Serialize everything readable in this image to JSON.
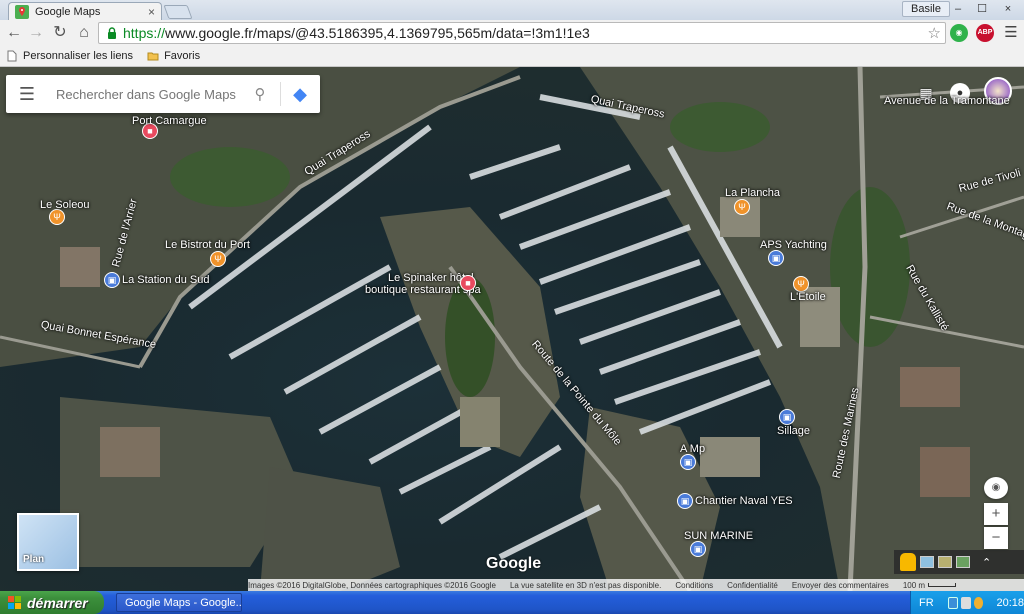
{
  "browser": {
    "tab_title": "Google Maps",
    "tab_close": "×",
    "user_name": "Basile",
    "win_minimize": "–",
    "win_maximize": "☐",
    "win_close": "×",
    "url_scheme": "https://",
    "url_rest": "www.google.fr/maps/@43.5186395,4.1369795,565m/data=!3m1!1e3",
    "ext_abp": "ABP",
    "bookmarks": [
      {
        "label": "Personnaliser les liens",
        "icon": "page-icon"
      },
      {
        "label": "Favoris",
        "icon": "folder-icon"
      }
    ]
  },
  "map": {
    "search_placeholder": "Rechercher dans Google Maps",
    "plan_label": "Plan",
    "logo": "Google",
    "labels": [
      {
        "text": "Port Camargue",
        "name": "label-port-camargue"
      },
      {
        "text": "Le Soleou",
        "name": "label-le-soleou"
      },
      {
        "text": "Le Bistrot du Port",
        "name": "label-le-bistrot-du-port"
      },
      {
        "text": "La Station du Sud",
        "name": "label-la-station-du-sud"
      },
      {
        "text": "Le Spinaker hôtel",
        "name": "label-le-spinaker-1"
      },
      {
        "text": "boutique restaurant spa",
        "name": "label-le-spinaker-2"
      },
      {
        "text": "La Plancha",
        "name": "label-la-plancha"
      },
      {
        "text": "APS Yachting",
        "name": "label-aps-yachting"
      },
      {
        "text": "L'Etoile",
        "name": "label-l-etoile"
      },
      {
        "text": "Sillage",
        "name": "label-sillage"
      },
      {
        "text": "A Mp",
        "name": "label-a-mp"
      },
      {
        "text": "Chantier Naval YES",
        "name": "label-chantier-naval-yes"
      },
      {
        "text": "SUN MARINE",
        "name": "label-sun-marine"
      },
      {
        "text": "Quai Trapeross",
        "name": "label-quai-trapeross"
      },
      {
        "text": "Quai Trapeross",
        "name": "label-quai-trapeross-2"
      },
      {
        "text": "Quai Bonnet Espérance",
        "name": "label-quai-bonnet"
      },
      {
        "text": "Route de la Pointe du Môle",
        "name": "label-route-pointe"
      },
      {
        "text": "Route des Marines",
        "name": "label-route-marines"
      },
      {
        "text": "Avenue de la Tramontane",
        "name": "label-avenue-tramontane"
      },
      {
        "text": "Rue de Tivoli",
        "name": "label-rue-tivoli"
      },
      {
        "text": "Rue de la Montagne",
        "name": "label-rue-montagne"
      },
      {
        "text": "Rue du Kallisté",
        "name": "label-rue-kalliste"
      },
      {
        "text": "Rue de l'Arrier",
        "name": "label-rue-arrier"
      }
    ],
    "footer": {
      "imagery": "Images ©2016 DigitalGlobe, Données cartographiques ©2016 Google",
      "notice": "La vue satellite en 3D n'est pas disponible.",
      "terms": "Conditions",
      "privacy": "Confidentialité",
      "feedback": "Envoyer des commentaires",
      "scale": "100 m"
    }
  },
  "taskbar": {
    "start_label": "démarrer",
    "task_title": "Google Maps - Google...",
    "lang": "FR",
    "time": "20:18"
  }
}
